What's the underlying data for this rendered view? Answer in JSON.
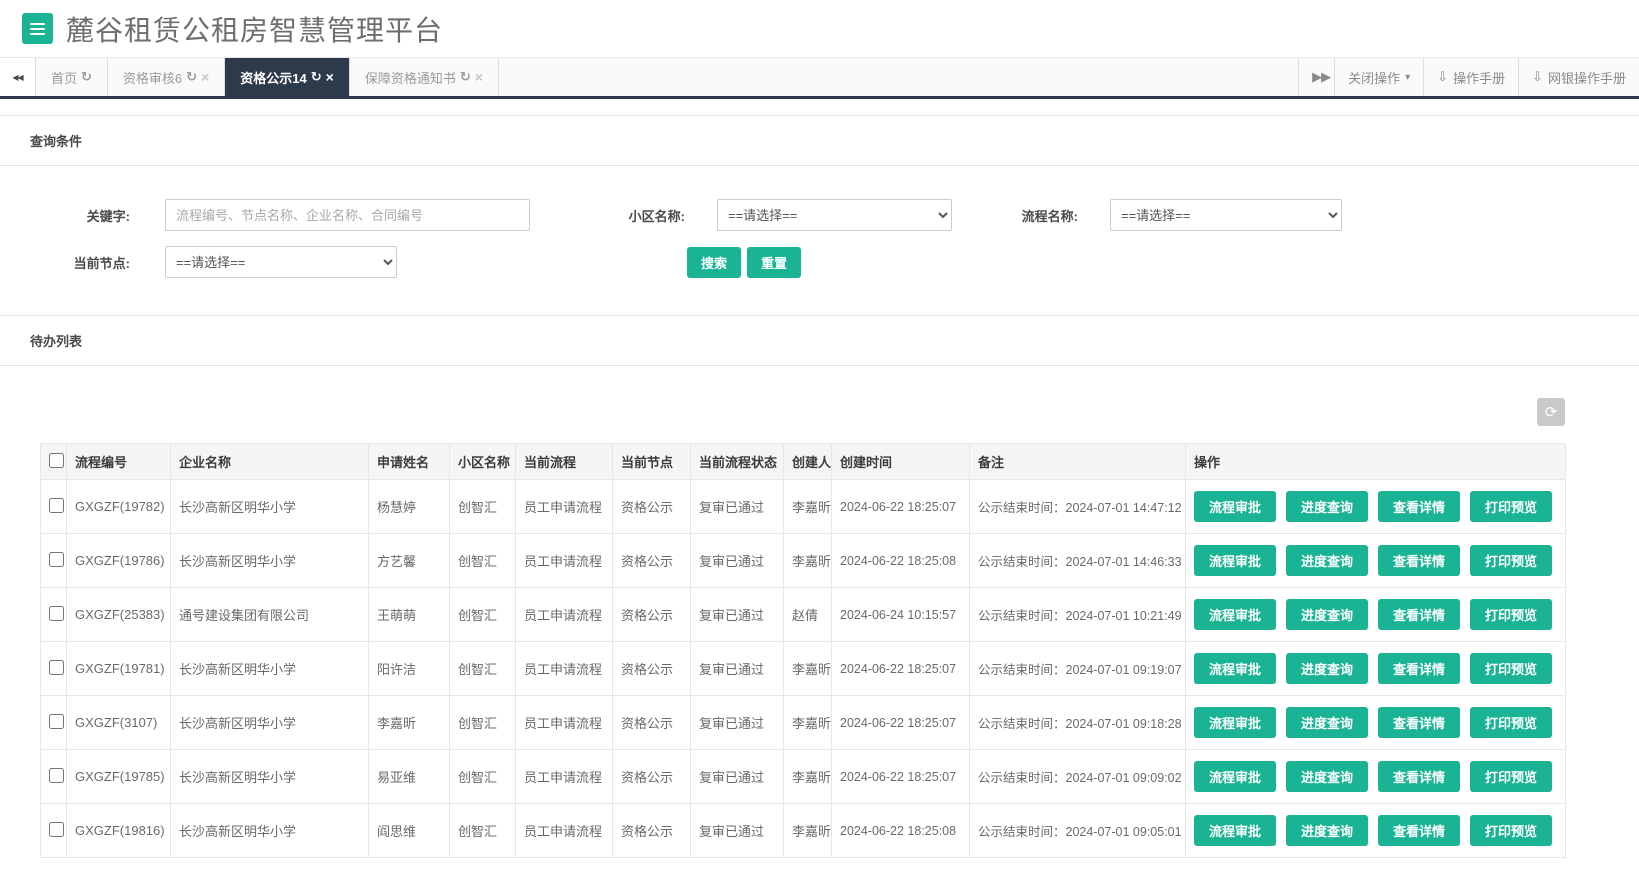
{
  "header": {
    "title": "麓谷租赁公租房智慧管理平台"
  },
  "icons": {
    "double_left": "◀◀",
    "double_right": "▶▶",
    "tab_refresh": "↻",
    "tab_close": "×",
    "caret_down": "▾",
    "download": "⇩",
    "toolbar_refresh": "⟳"
  },
  "colors": {
    "primary": "#1ab394",
    "tab_active_bg": "#2d3a4b"
  },
  "tabbar": {
    "tabs": [
      {
        "name": "tab-home",
        "label": "首页",
        "closable": false,
        "active": false
      },
      {
        "name": "tab-qualification-review",
        "label": "资格审核6",
        "closable": true,
        "active": false
      },
      {
        "name": "tab-qualification-publicity",
        "label": "资格公示14",
        "closable": true,
        "active": true
      },
      {
        "name": "tab-guarantee-qualification-notice",
        "label": "保障资格通知书",
        "closable": true,
        "active": false
      }
    ],
    "close_ops_label": "关闭操作",
    "manual_label": "操作手册",
    "bank_manual_label": "网银操作手册"
  },
  "query": {
    "title": "查询条件",
    "keyword_label": "关键字:",
    "keyword_placeholder": "流程编号、节点名称、企业名称、合同编号",
    "community_label": "小区名称:",
    "community_value": "==请选择==",
    "process_label": "流程名称:",
    "process_value": "==请选择==",
    "node_label": "当前节点:",
    "node_value": "==请选择==",
    "search_label": "搜索",
    "reset_label": "重置"
  },
  "todo": {
    "title": "待办列表",
    "columns": [
      "流程编号",
      "企业名称",
      "申请姓名",
      "小区名称",
      "当前流程",
      "当前节点",
      "当前流程状态",
      "创建人",
      "创建时间",
      "备注",
      "操作"
    ],
    "action_labels": [
      "流程审批",
      "进度查询",
      "查看详情",
      "打印预览"
    ],
    "rows": [
      {
        "no": "GXGZF(19782)",
        "company": "长沙高新区明华小学",
        "applicant": "杨慧婷",
        "community": "创智汇",
        "process": "员工申请流程",
        "node": "资格公示",
        "status": "复审已通过",
        "creator": "李嘉昕",
        "created": "2024-06-22 18:25:07",
        "remark": "公示结束时间：2024-07-01 14:47:12"
      },
      {
        "no": "GXGZF(19786)",
        "company": "长沙高新区明华小学",
        "applicant": "方艺馨",
        "community": "创智汇",
        "process": "员工申请流程",
        "node": "资格公示",
        "status": "复审已通过",
        "creator": "李嘉昕",
        "created": "2024-06-22 18:25:08",
        "remark": "公示结束时间：2024-07-01 14:46:33"
      },
      {
        "no": "GXGZF(25383)",
        "company": "通号建设集团有限公司",
        "applicant": "王萌萌",
        "community": "创智汇",
        "process": "员工申请流程",
        "node": "资格公示",
        "status": "复审已通过",
        "creator": "赵倩",
        "created": "2024-06-24 10:15:57",
        "remark": "公示结束时间：2024-07-01 10:21:49"
      },
      {
        "no": "GXGZF(19781)",
        "company": "长沙高新区明华小学",
        "applicant": "阳许洁",
        "community": "创智汇",
        "process": "员工申请流程",
        "node": "资格公示",
        "status": "复审已通过",
        "creator": "李嘉昕",
        "created": "2024-06-22 18:25:07",
        "remark": "公示结束时间：2024-07-01 09:19:07"
      },
      {
        "no": "GXGZF(3107)",
        "company": "长沙高新区明华小学",
        "applicant": "李嘉昕",
        "community": "创智汇",
        "process": "员工申请流程",
        "node": "资格公示",
        "status": "复审已通过",
        "creator": "李嘉昕",
        "created": "2024-06-22 18:25:07",
        "remark": "公示结束时间：2024-07-01 09:18:28"
      },
      {
        "no": "GXGZF(19785)",
        "company": "长沙高新区明华小学",
        "applicant": "易亚维",
        "community": "创智汇",
        "process": "员工申请流程",
        "node": "资格公示",
        "status": "复审已通过",
        "creator": "李嘉昕",
        "created": "2024-06-22 18:25:07",
        "remark": "公示结束时间：2024-07-01 09:09:02"
      },
      {
        "no": "GXGZF(19816)",
        "company": "长沙高新区明华小学",
        "applicant": "阎思维",
        "community": "创智汇",
        "process": "员工申请流程",
        "node": "资格公示",
        "status": "复审已通过",
        "creator": "李嘉昕",
        "created": "2024-06-22 18:25:08",
        "remark": "公示结束时间：2024-07-01 09:05:01"
      }
    ]
  }
}
